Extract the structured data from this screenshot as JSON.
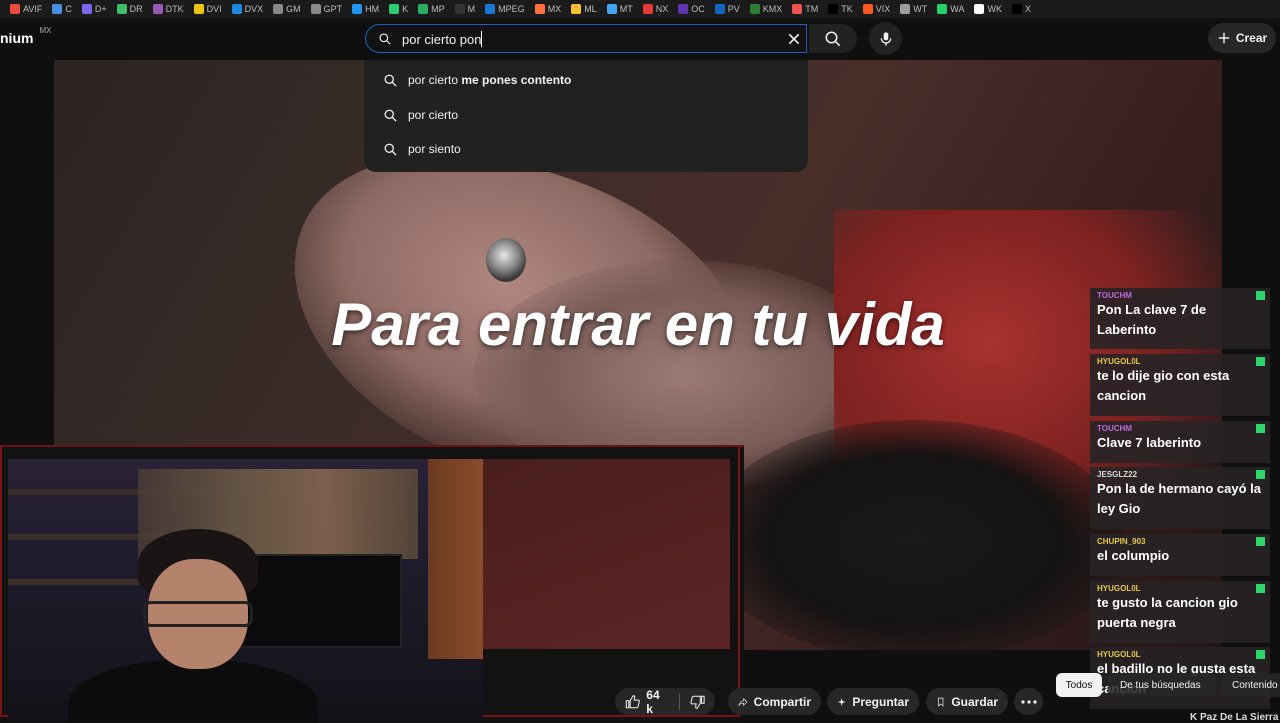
{
  "bookmarks": [
    "AVIF",
    "C",
    "D+",
    "DR",
    "DTK",
    "DVI",
    "DVX",
    "GM",
    "GPT",
    "HM",
    "K",
    "MP",
    "M",
    "MPEG",
    "MX",
    "ML",
    "MT",
    "NX",
    "OC",
    "PV",
    "KMX",
    "TM",
    "TK",
    "VIX",
    "WT",
    "WA",
    "WK",
    "X"
  ],
  "bookmark_colors": [
    "#e84c3d",
    "#4a90e2",
    "#7b68ee",
    "#3dbf6a",
    "#9b59b6",
    "#f1c40f",
    "#1e88e5",
    "#888888",
    "#8a8a8a",
    "#2196f3",
    "#2ecc71",
    "#27ae60",
    "#333333",
    "#1976d2",
    "#ff7043",
    "#fbc02d",
    "#42a5f5",
    "#e53935",
    "#5e35b1",
    "#1565c0",
    "#2e7d32",
    "#ef5350",
    "#000000",
    "#ff5722",
    "#9e9e9e",
    "#25d366",
    "#ffffff",
    "#000000"
  ],
  "header": {
    "logo_text": "nium",
    "region": "MX",
    "create_label": "Crear"
  },
  "search": {
    "value": "por cierto pon",
    "suggestions": [
      {
        "prefix": "por cierto",
        "completion": " me pones contento"
      },
      {
        "prefix": "por cierto",
        "completion": ""
      },
      {
        "prefix": "por siento",
        "completion": ""
      }
    ]
  },
  "video": {
    "caption": "Para entrar en tu vida"
  },
  "actions": {
    "likes": "64 k",
    "share": "Compartir",
    "ask": "Preguntar",
    "save": "Guardar"
  },
  "chat": [
    {
      "user": "TOUCHM",
      "user_color": "#b86ad6",
      "text": "Pon La clave 7 de Laberinto"
    },
    {
      "user": "HYUGOL0L",
      "user_color": "#e6c84a",
      "text": "te lo dije gio con esta cancion"
    },
    {
      "user": "TOUCHM",
      "user_color": "#b86ad6",
      "text": "Clave 7 laberinto"
    },
    {
      "user": "JESGLZ22",
      "user_color": "#d9d9d9",
      "text": "Pon la de hermano cayó la ley Gio"
    },
    {
      "user": "CHUPIN_903",
      "user_color": "#e6c84a",
      "text": "el columpio"
    },
    {
      "user": "HYUGOL0L",
      "user_color": "#e6c84a",
      "text": "te gusto la cancion gio puerta negra"
    },
    {
      "user": "HYUGOL0L",
      "user_color": "#e6c84a",
      "text": "el badillo no le gusta esta cancion"
    }
  ],
  "chips": [
    "Todos",
    "De tus búsquedas",
    "Contenido"
  ],
  "related_title": "K Paz De La Sierra"
}
